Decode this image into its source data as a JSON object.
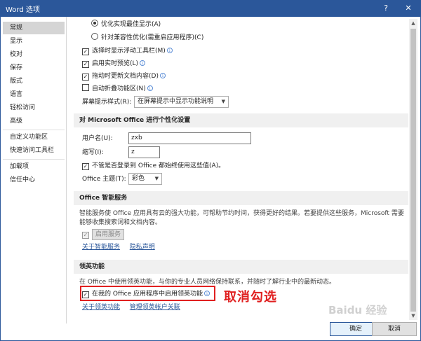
{
  "window": {
    "title": "Word 选项",
    "help": "?",
    "close": "✕"
  },
  "sidebar": {
    "items": [
      {
        "label": "常规",
        "active": true
      },
      {
        "label": "显示"
      },
      {
        "label": "校对"
      },
      {
        "label": "保存"
      },
      {
        "label": "版式"
      },
      {
        "label": "语言"
      },
      {
        "label": "轻松访问"
      },
      {
        "label": "高级"
      },
      {
        "label": "自定义功能区"
      },
      {
        "label": "快速访问工具栏"
      },
      {
        "label": "加载项"
      },
      {
        "label": "信任中心"
      }
    ]
  },
  "ui_options": {
    "radio_best_display": "优化实现最佳显示(A)",
    "radio_compat": "针对兼容性优化(需重启应用程序)(C)",
    "cb_mini_toolbar": "选择时显示浮动工具栏(M)",
    "cb_live_preview": "启用实时预览(L)",
    "cb_update_drag": "拖动时更新文档内容(D)",
    "cb_collapse_ribbon": "自动折叠功能区(N)",
    "screentip_label": "屏幕提示样式(R):",
    "screentip_value": "在屏幕提示中显示功能说明"
  },
  "personalize": {
    "header": "对 Microsoft Office 进行个性化设置",
    "username_label": "用户名(U):",
    "username_value": "zxb",
    "initials_label": "缩写(I):",
    "initials_value": "z",
    "cb_always_use": "不管是否登录到 Office 都始终使用这些值(A)。",
    "theme_label": "Office 主题(T):",
    "theme_value": "彩色"
  },
  "intelligent": {
    "header": "Office 智能服务",
    "desc": "智能服务使 Office 应用具有云的强大功能，可帮助节约时间，获得更好的结果。若要提供这些服务，Microsoft 需要能够收集搜索词和文档内容。",
    "enable_label": "启用服务",
    "link_about": "关于智能服务",
    "link_privacy": "隐私声明"
  },
  "linkedin": {
    "header": "领英功能",
    "desc": "在 Office 中使用领英功能，与你的专业人员网络保持联系，并随时了解行业中的最新动态。",
    "cb_enable": "在我的 Office 应用程序中启用领英功能",
    "link_about": "关于领英功能",
    "link_manage": "管理领英帐户关联"
  },
  "footer": {
    "ok": "确定",
    "cancel": "取消"
  },
  "annotation": {
    "text": "取消勾选"
  },
  "watermark": "Baidu 经验",
  "colors": {
    "titlebar": "#2b579a",
    "annotation": "#e02020",
    "link": "#2b579a"
  }
}
